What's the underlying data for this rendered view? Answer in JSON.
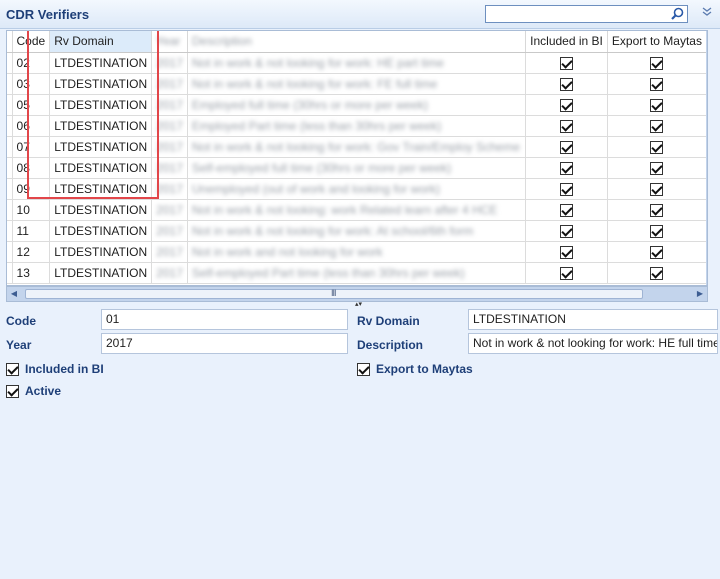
{
  "window": {
    "title": "CDR Verifiers",
    "search": {
      "value": "",
      "placeholder": ""
    },
    "collapse_icon": "double-chevron-down-icon"
  },
  "grid": {
    "columns": [
      "Code",
      "Rv Domain",
      "Year",
      "Description",
      "Included in BI",
      "Export to Maytas"
    ],
    "rows": [
      {
        "code": "02",
        "rv_domain": "LTDESTINATION",
        "year": "2017",
        "description": "Not in work & not looking for work: HE part time",
        "included_in_bi": true,
        "export_to_maytas": true
      },
      {
        "code": "03",
        "rv_domain": "LTDESTINATION",
        "year": "2017",
        "description": "Not in work & not looking for work: FE full time",
        "included_in_bi": true,
        "export_to_maytas": true
      },
      {
        "code": "05",
        "rv_domain": "LTDESTINATION",
        "year": "2017",
        "description": "Employed full time (30hrs or more per week)",
        "included_in_bi": true,
        "export_to_maytas": true
      },
      {
        "code": "06",
        "rv_domain": "LTDESTINATION",
        "year": "2017",
        "description": "Employed Part time (less than 30hrs per week)",
        "included_in_bi": true,
        "export_to_maytas": true
      },
      {
        "code": "07",
        "rv_domain": "LTDESTINATION",
        "year": "2017",
        "description": "Not in work & not looking for work: Gov Train/Employ Scheme",
        "included_in_bi": true,
        "export_to_maytas": true
      },
      {
        "code": "08",
        "rv_domain": "LTDESTINATION",
        "year": "2017",
        "description": "Self-employed full time (30hrs or more per week)",
        "included_in_bi": true,
        "export_to_maytas": true
      },
      {
        "code": "09",
        "rv_domain": "LTDESTINATION",
        "year": "2017",
        "description": "Unemployed (out of work and looking for work)",
        "included_in_bi": true,
        "export_to_maytas": true
      },
      {
        "code": "10",
        "rv_domain": "LTDESTINATION",
        "year": "2017",
        "description": "Not in work & not looking: work Related learn after 4 HCE",
        "included_in_bi": true,
        "export_to_maytas": true
      },
      {
        "code": "11",
        "rv_domain": "LTDESTINATION",
        "year": "2017",
        "description": "Not in work & not looking for work: At school/6th form",
        "included_in_bi": true,
        "export_to_maytas": true
      },
      {
        "code": "12",
        "rv_domain": "LTDESTINATION",
        "year": "2017",
        "description": "Not in work and not looking for work",
        "included_in_bi": true,
        "export_to_maytas": true
      },
      {
        "code": "13",
        "rv_domain": "LTDESTINATION",
        "year": "2017",
        "description": "Self-employed Part time (less than 30hrs per week)",
        "included_in_bi": true,
        "export_to_maytas": true
      }
    ],
    "hscroll_grip": "III",
    "splitter_glyph": "▴▾"
  },
  "detail": {
    "code_label": "Code",
    "code_value": "01",
    "year_label": "Year",
    "year_value": "2017",
    "rv_domain_label": "Rv Domain",
    "rv_domain_value": "LTDESTINATION",
    "description_label": "Description",
    "description_value": "Not in work & not looking for work: HE full time",
    "included_in_bi_label": "Included in BI",
    "included_in_bi": true,
    "export_to_maytas_label": "Export to Maytas",
    "export_to_maytas": true,
    "active_label": "Active",
    "active": true
  },
  "colors": {
    "accent": "#1e3f78",
    "background": "#e9f1fc",
    "highlight": "#e2464a"
  }
}
